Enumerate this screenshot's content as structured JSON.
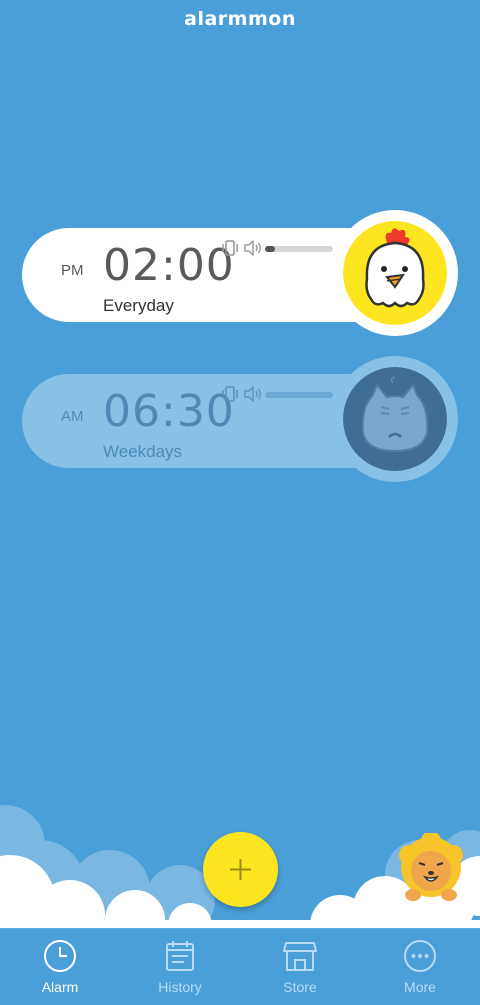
{
  "app": {
    "logo_text": "alarmmon"
  },
  "alarms": [
    {
      "ampm": "PM",
      "time": "02:00",
      "repeat": "Everyday",
      "enabled": true,
      "volume": 0.15,
      "mascot": "chicken-mascot"
    },
    {
      "ampm": "AM",
      "time": "06:30",
      "repeat": "Weekdays",
      "enabled": false,
      "volume": 0.0,
      "mascot": "cat-mascot"
    }
  ],
  "fab": {
    "icon": "plus-icon"
  },
  "nav": {
    "items": [
      {
        "label": "Alarm",
        "icon": "clock-icon",
        "active": true
      },
      {
        "label": "History",
        "icon": "calendar-icon",
        "active": false
      },
      {
        "label": "Store",
        "icon": "store-icon",
        "active": false
      },
      {
        "label": "More",
        "icon": "more-icon",
        "active": false
      }
    ]
  },
  "colors": {
    "background": "#4a9fd8",
    "fab": "#fde51f",
    "card_active": "#ffffff",
    "card_disabled": "#87c1e8",
    "text_dark": "#5a5a5a"
  }
}
